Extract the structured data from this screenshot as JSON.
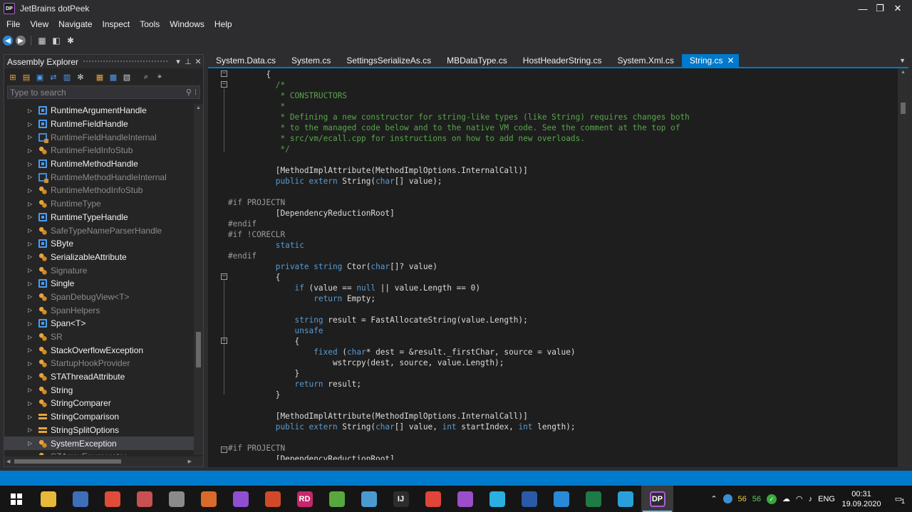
{
  "window": {
    "title": "JetBrains dotPeek",
    "logo_text": "DP",
    "controls": [
      "—",
      "❐",
      "✕"
    ]
  },
  "menu": [
    "File",
    "View",
    "Navigate",
    "Inspect",
    "Tools",
    "Windows",
    "Help"
  ],
  "explorer": {
    "title": "Assembly Explorer",
    "header_buttons": [
      "▾",
      "⊥",
      "✕"
    ],
    "search_placeholder": "Type to search",
    "items": [
      {
        "label": "RuntimeArgumentHandle",
        "kind": "class",
        "dim": false
      },
      {
        "label": "RuntimeFieldHandle",
        "kind": "class",
        "dim": false
      },
      {
        "label": "RuntimeFieldHandleInternal",
        "kind": "internal",
        "dim": true
      },
      {
        "label": "RuntimeFieldInfoStub",
        "kind": "struct",
        "dim": true
      },
      {
        "label": "RuntimeMethodHandle",
        "kind": "class",
        "dim": false
      },
      {
        "label": "RuntimeMethodHandleInternal",
        "kind": "internal",
        "dim": true
      },
      {
        "label": "RuntimeMethodInfoStub",
        "kind": "struct",
        "dim": true
      },
      {
        "label": "RuntimeType",
        "kind": "struct",
        "dim": true
      },
      {
        "label": "RuntimeTypeHandle",
        "kind": "class",
        "dim": false
      },
      {
        "label": "SafeTypeNameParserHandle",
        "kind": "struct",
        "dim": true
      },
      {
        "label": "SByte",
        "kind": "class",
        "dim": false
      },
      {
        "label": "SerializableAttribute",
        "kind": "struct",
        "dim": false
      },
      {
        "label": "Signature",
        "kind": "struct",
        "dim": true
      },
      {
        "label": "Single",
        "kind": "class",
        "dim": false
      },
      {
        "label": "SpanDebugView<T>",
        "kind": "struct",
        "dim": true
      },
      {
        "label": "SpanHelpers",
        "kind": "struct",
        "dim": true
      },
      {
        "label": "Span<T>",
        "kind": "class",
        "dim": false
      },
      {
        "label": "SR",
        "kind": "struct",
        "dim": true
      },
      {
        "label": "StackOverflowException",
        "kind": "struct",
        "dim": false
      },
      {
        "label": "StartupHookProvider",
        "kind": "struct",
        "dim": true
      },
      {
        "label": "STAThreadAttribute",
        "kind": "struct",
        "dim": false
      },
      {
        "label": "String",
        "kind": "struct",
        "dim": false
      },
      {
        "label": "StringComparer",
        "kind": "struct",
        "dim": false
      },
      {
        "label": "StringComparison",
        "kind": "enum",
        "dim": false
      },
      {
        "label": "StringSplitOptions",
        "kind": "enum",
        "dim": false
      },
      {
        "label": "SystemException",
        "kind": "struct",
        "dim": false,
        "selected": true
      },
      {
        "label": "SZArrayEnumerator",
        "kind": "struct",
        "dim": true
      }
    ]
  },
  "tabs": [
    {
      "label": "System.Data.cs",
      "active": false
    },
    {
      "label": "System.cs",
      "active": false
    },
    {
      "label": "SettingsSerializeAs.cs",
      "active": false
    },
    {
      "label": "MBDataType.cs",
      "active": false
    },
    {
      "label": "HostHeaderString.cs",
      "active": false
    },
    {
      "label": "System.Xml.cs",
      "active": false
    },
    {
      "label": "String.cs",
      "active": true
    }
  ],
  "code_lines": [
    [
      [
        "        {",
        "p"
      ]
    ],
    [
      [
        "          /*",
        "c"
      ]
    ],
    [
      [
        "           * CONSTRUCTORS",
        "c"
      ]
    ],
    [
      [
        "           *",
        "c"
      ]
    ],
    [
      [
        "           * Defining a new constructor for string-like types (like String) requires changes both",
        "c"
      ]
    ],
    [
      [
        "           * to the managed code below and to the native VM code. See the comment at the top of",
        "c"
      ]
    ],
    [
      [
        "           * src/vm/ecall.cpp for instructions on how to add new overloads.",
        "c"
      ]
    ],
    [
      [
        "           */",
        "c"
      ]
    ],
    [
      [
        "",
        "p"
      ]
    ],
    [
      [
        "          [MethodImplAttribute(MethodImplOptions.InternalCall)]",
        "p"
      ]
    ],
    [
      [
        "          ",
        "p"
      ],
      [
        "public extern",
        "k"
      ],
      [
        " String(",
        "p"
      ],
      [
        "char",
        "k"
      ],
      [
        "[] value);",
        "p"
      ]
    ],
    [
      [
        "",
        "p"
      ]
    ],
    [
      [
        "#if PROJECTN",
        "h"
      ]
    ],
    [
      [
        "          [DependencyReductionRoot]",
        "p"
      ]
    ],
    [
      [
        "#endif",
        "h"
      ]
    ],
    [
      [
        "#if !CORECLR",
        "h"
      ]
    ],
    [
      [
        "          ",
        "p"
      ],
      [
        "static",
        "k"
      ]
    ],
    [
      [
        "#endif",
        "h"
      ]
    ],
    [
      [
        "          ",
        "p"
      ],
      [
        "private string",
        "k"
      ],
      [
        " Ctor(",
        "p"
      ],
      [
        "char",
        "k"
      ],
      [
        "[]? value)",
        "p"
      ]
    ],
    [
      [
        "          {",
        "p"
      ]
    ],
    [
      [
        "              ",
        "p"
      ],
      [
        "if",
        "k"
      ],
      [
        " (value == ",
        "p"
      ],
      [
        "null",
        "k"
      ],
      [
        " || value.Length == 0)",
        "p"
      ]
    ],
    [
      [
        "                  ",
        "p"
      ],
      [
        "return",
        "k"
      ],
      [
        " Empty;",
        "p"
      ]
    ],
    [
      [
        "",
        "p"
      ]
    ],
    [
      [
        "              ",
        "p"
      ],
      [
        "string",
        "k"
      ],
      [
        " result = FastAllocateString(value.Length);",
        "p"
      ]
    ],
    [
      [
        "              ",
        "p"
      ],
      [
        "unsafe",
        "k"
      ]
    ],
    [
      [
        "              {",
        "p"
      ]
    ],
    [
      [
        "                  ",
        "p"
      ],
      [
        "fixed",
        "k"
      ],
      [
        " (",
        "p"
      ],
      [
        "char",
        "k"
      ],
      [
        "* dest = &result._firstChar, source = value)",
        "p"
      ]
    ],
    [
      [
        "                      wstrcpy(dest, source, value.Length);",
        "p"
      ]
    ],
    [
      [
        "              }",
        "p"
      ]
    ],
    [
      [
        "              ",
        "p"
      ],
      [
        "return",
        "k"
      ],
      [
        " result;",
        "p"
      ]
    ],
    [
      [
        "          }",
        "p"
      ]
    ],
    [
      [
        "",
        "p"
      ]
    ],
    [
      [
        "          [MethodImplAttribute(MethodImplOptions.InternalCall)]",
        "p"
      ]
    ],
    [
      [
        "          ",
        "p"
      ],
      [
        "public extern",
        "k"
      ],
      [
        " String(",
        "p"
      ],
      [
        "char",
        "k"
      ],
      [
        "[] value, ",
        "p"
      ],
      [
        "int",
        "k"
      ],
      [
        " startIndex, ",
        "p"
      ],
      [
        "int",
        "k"
      ],
      [
        " length);",
        "p"
      ]
    ],
    [
      [
        "",
        "p"
      ]
    ],
    [
      [
        "#if PROJECTN",
        "h"
      ]
    ],
    [
      [
        "          [DependencyReductionRoot]",
        "p"
      ]
    ]
  ],
  "taskbar": {
    "apps": [
      {
        "name": "file-explorer",
        "glyph": "",
        "color": "#e8b838"
      },
      {
        "name": "save-app",
        "glyph": "",
        "color": "#3d6fb8"
      },
      {
        "name": "chrome",
        "glyph": "",
        "color": "#e04b3a"
      },
      {
        "name": "app-4",
        "glyph": "",
        "color": "#c85050"
      },
      {
        "name": "app-5",
        "glyph": "",
        "color": "#8a8a8a"
      },
      {
        "name": "app-6",
        "glyph": "",
        "color": "#d86a2b"
      },
      {
        "name": "visual-studio",
        "glyph": "",
        "color": "#8f4fd0"
      },
      {
        "name": "git-app",
        "glyph": "",
        "color": "#d04a2a"
      },
      {
        "name": "rider",
        "glyph": "RD",
        "color": "#c8266a"
      },
      {
        "name": "app-10",
        "glyph": "",
        "color": "#58a83e"
      },
      {
        "name": "app-11",
        "glyph": "",
        "color": "#4a9ad0"
      },
      {
        "name": "intellij",
        "glyph": "IJ",
        "color": "#2d2d2d"
      },
      {
        "name": "app-13",
        "glyph": "",
        "color": "#e0443a"
      },
      {
        "name": "app-14",
        "glyph": "",
        "color": "#9a4fc8"
      },
      {
        "name": "app-15",
        "glyph": "",
        "color": "#2ab0e0"
      },
      {
        "name": "powershell",
        "glyph": "",
        "color": "#2a5aa8"
      },
      {
        "name": "vscode",
        "glyph": "",
        "color": "#2a8ad8"
      },
      {
        "name": "excel",
        "glyph": "",
        "color": "#1f7a45"
      },
      {
        "name": "telegram",
        "glyph": "",
        "color": "#2aa0d8"
      },
      {
        "name": "dotpeek",
        "glyph": "DP",
        "color": "#2d2d30",
        "active": true
      }
    ],
    "tray": {
      "counter_a": "56",
      "counter_b": "56",
      "language": "ENG",
      "time": "00:31",
      "date": "19.09.2020",
      "notifications": "1"
    }
  }
}
